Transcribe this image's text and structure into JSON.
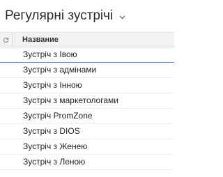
{
  "header": {
    "title": "Регулярні зустрічі"
  },
  "grid": {
    "column_name": "Название",
    "rows": [
      "Зустріч з Івою",
      "Зустріч з адмінами",
      "Зустріч з Інною",
      "Зустріч з маркетологами",
      "Зустріч PromZone",
      "Зустріч з DIOS",
      "Зустріч з Женею",
      "Зустріч з Леною"
    ]
  },
  "colors": {
    "selection_border": "#4a90d9",
    "header_background": "#f2f2f2"
  },
  "icons": {
    "title_dropdown": "chevron-down-icon",
    "refresh": "refresh-icon"
  }
}
